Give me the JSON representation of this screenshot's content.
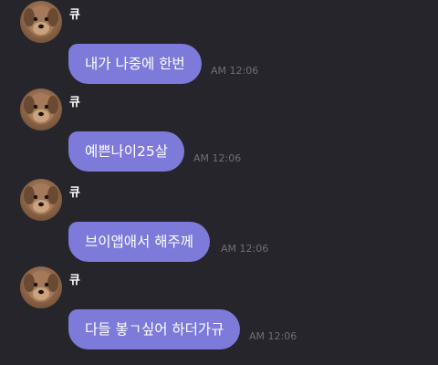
{
  "messages": [
    {
      "sender": "큐",
      "text": "내가 나중에 한번",
      "time": "AM 12:06"
    },
    {
      "sender": "큐",
      "text": "예쁜나이25살",
      "time": "AM 12:06"
    },
    {
      "sender": "큐",
      "text": "브이앱애서 해주께",
      "time": "AM 12:06"
    },
    {
      "sender": "큐",
      "text": "다들 봏ㄱ싶어 하더가규",
      "time": "AM 12:06"
    }
  ],
  "colors": {
    "background": "#25252b",
    "bubble": "#7d7ad9",
    "timestamp": "#6e6e78"
  },
  "icons": {
    "avatar": "dog-avatar-icon"
  }
}
